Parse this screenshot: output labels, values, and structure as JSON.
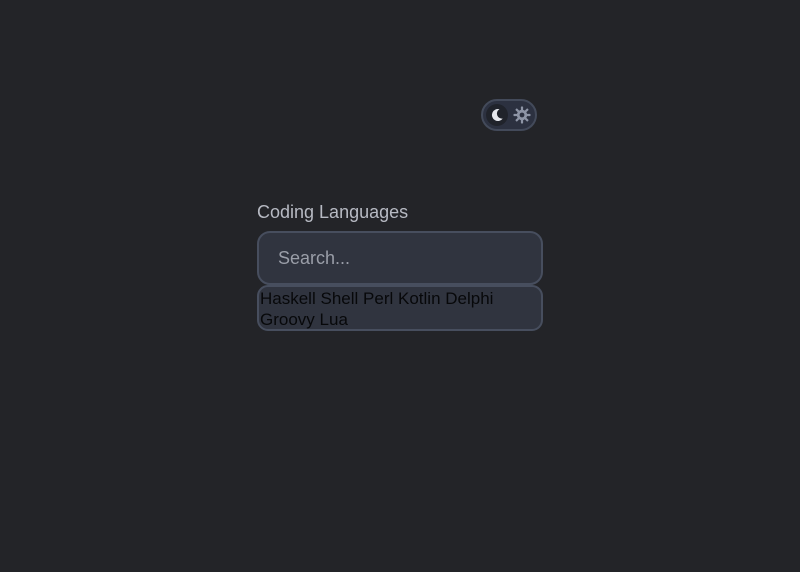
{
  "theme_toggle": {
    "mode": "dark",
    "active_icon": "moon-icon",
    "inactive_icon": "gear-icon"
  },
  "combobox": {
    "label": "Coding Languages",
    "search_value": "",
    "search_placeholder": "Search...",
    "options": [
      "Haskell",
      "Shell",
      "Perl",
      "Kotlin",
      "Delphi",
      "Groovy",
      "Lua"
    ]
  },
  "colors": {
    "background": "#232428",
    "field_background": "#30343f",
    "field_border": "#474e5e",
    "label_text": "#b7bac3",
    "option_text": "#07080a"
  }
}
